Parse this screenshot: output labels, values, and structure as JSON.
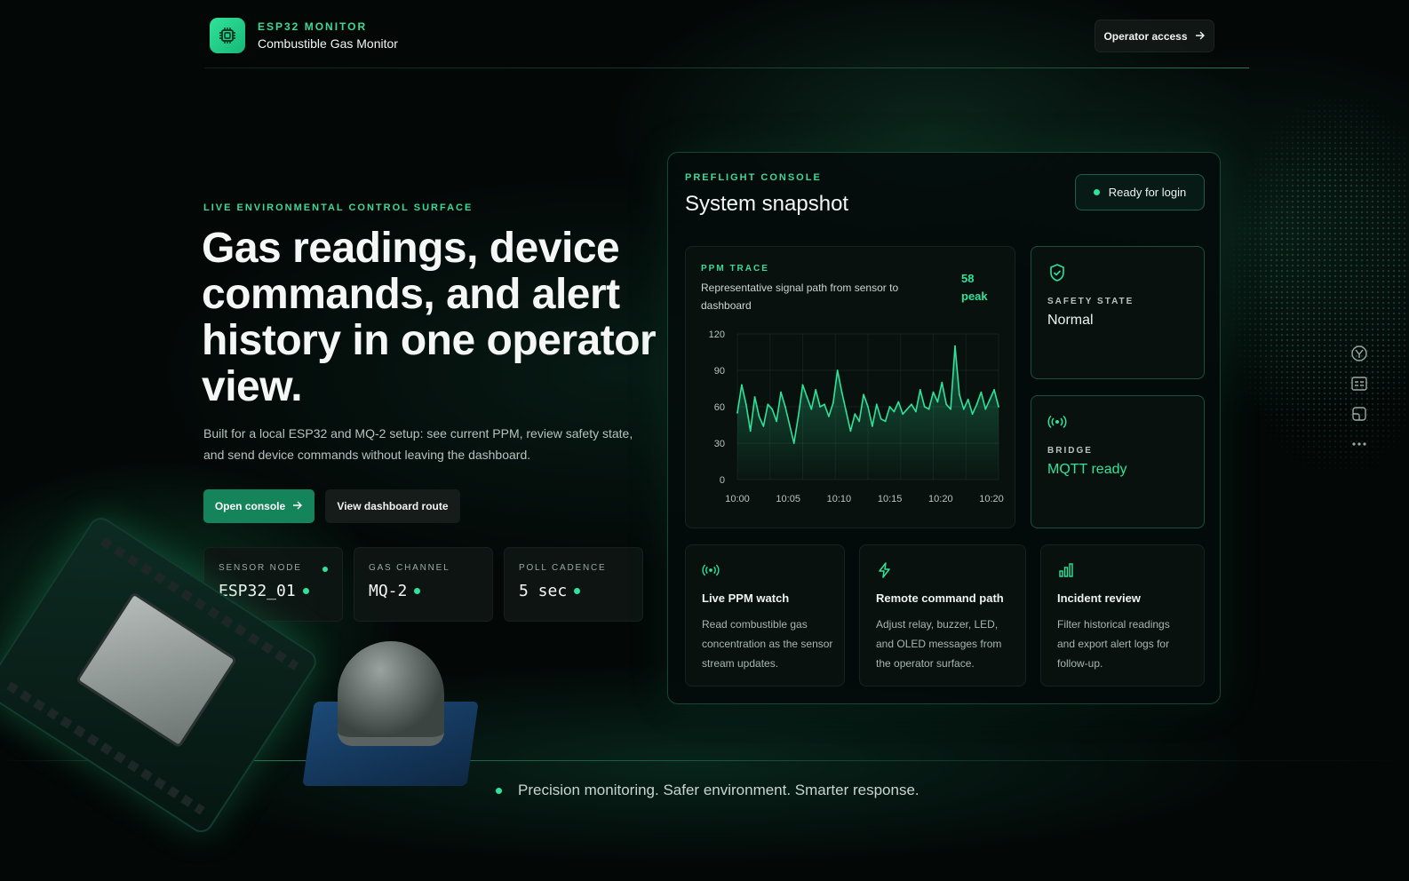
{
  "header": {
    "kicker": "ESP32 MONITOR",
    "title": "Combustible Gas Monitor",
    "operator_button": "Operator access"
  },
  "hero": {
    "kicker": "LIVE ENVIRONMENTAL CONTROL SURFACE",
    "headline": "Gas readings, device commands, and alert history in one operator view.",
    "lede": "Built for a local ESP32 and MQ-2 setup: see current PPM, review safety state, and send device commands without leaving the dashboard.",
    "primary_button": "Open console",
    "secondary_button": "View dashboard route",
    "stats": [
      {
        "label": "SENSOR NODE",
        "value": "ESP32_01"
      },
      {
        "label": "GAS CHANNEL",
        "value": "MQ-2"
      },
      {
        "label": "POLL CADENCE",
        "value": "5 sec"
      }
    ]
  },
  "console": {
    "kicker": "PREFLIGHT CONSOLE",
    "title": "System snapshot",
    "status_pill": "Ready for login",
    "trace": {
      "kicker": "PPM TRACE",
      "description": "Representative signal path from sensor to dashboard",
      "peak_value": "58",
      "peak_label": "peak"
    },
    "safety": {
      "label": "SAFETY STATE",
      "value": "Normal"
    },
    "bridge": {
      "label": "BRIDGE",
      "value": "MQTT ready"
    },
    "features": [
      {
        "icon": "broadcast-icon",
        "title": "Live PPM watch",
        "desc": "Read combustible gas concentration as the sensor stream updates."
      },
      {
        "icon": "lightning-icon",
        "title": "Remote command path",
        "desc": "Adjust relay, buzzer, LED, and OLED messages from the operator surface."
      },
      {
        "icon": "bar-chart-icon",
        "title": "Incident review",
        "desc": "Filter historical readings and export alert logs for follow-up."
      }
    ]
  },
  "tagline": "Precision monitoring. Safer environment. Smarter response.",
  "colors": {
    "accent": "#2fe39a",
    "accent_dark": "#15845a",
    "background": "#030807"
  },
  "chart_data": {
    "type": "line",
    "title": "PPM TRACE",
    "xlabel": "",
    "ylabel": "",
    "ylim": [
      0,
      120
    ],
    "yticks": [
      0,
      30,
      60,
      90,
      120
    ],
    "xticks": [
      "10:00",
      "10:05",
      "10:10",
      "10:15",
      "10:20",
      "10:20"
    ],
    "series": [
      {
        "values": [
          55,
          78,
          62,
          40,
          68,
          52,
          44,
          62,
          58,
          48,
          72,
          60,
          45,
          30,
          52,
          78,
          68,
          58,
          74,
          60,
          62,
          52,
          63,
          90,
          72,
          56,
          40,
          54,
          48,
          70,
          60,
          44,
          62,
          50,
          48,
          60,
          56,
          64,
          54,
          58,
          62,
          56,
          74,
          60,
          58,
          72,
          64,
          80,
          62,
          58,
          110,
          70,
          58,
          66,
          54,
          62,
          72,
          58,
          66,
          74,
          60
        ]
      }
    ]
  }
}
